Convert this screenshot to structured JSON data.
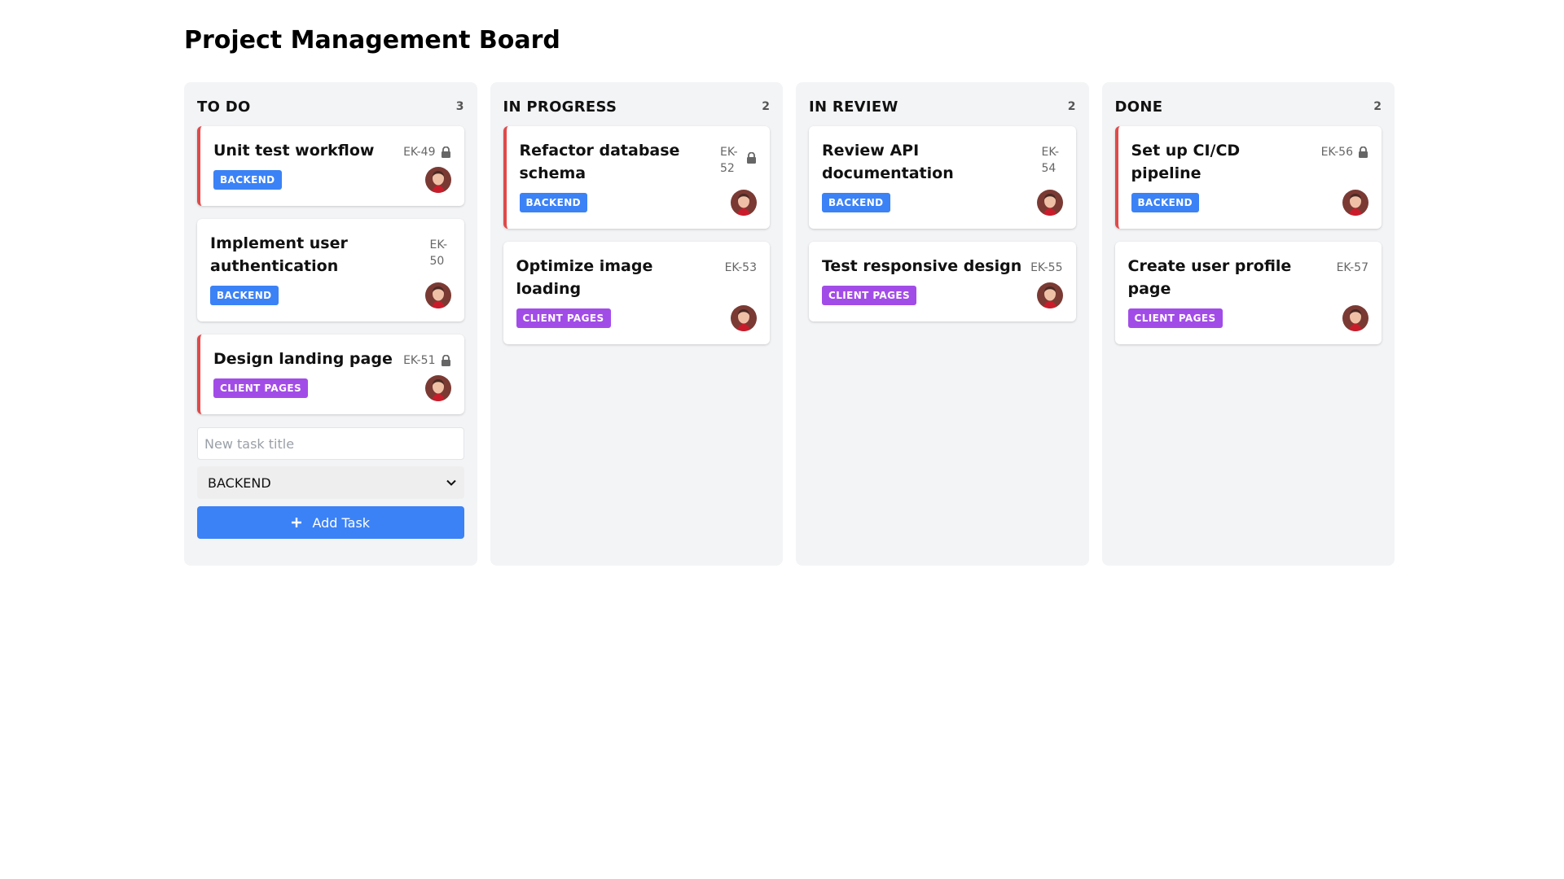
{
  "page_title": "Project Management Board",
  "columns": [
    {
      "title": "TO DO",
      "count": "3",
      "cards": [
        {
          "title": "Unit test workflow",
          "id": "EK-49",
          "tag": "BACKEND",
          "locked": true
        },
        {
          "title": "Implement user authentication",
          "id": "EK-50",
          "tag": "BACKEND",
          "locked": false
        },
        {
          "title": "Design landing page",
          "id": "EK-51",
          "tag": "CLIENT PAGES",
          "locked": true
        }
      ]
    },
    {
      "title": "IN PROGRESS",
      "count": "2",
      "cards": [
        {
          "title": "Refactor database schema",
          "id": "EK-52",
          "tag": "BACKEND",
          "locked": true
        },
        {
          "title": "Optimize image loading",
          "id": "EK-53",
          "tag": "CLIENT PAGES",
          "locked": false
        }
      ]
    },
    {
      "title": "IN REVIEW",
      "count": "2",
      "cards": [
        {
          "title": "Review API documentation",
          "id": "EK-54",
          "tag": "BACKEND",
          "locked": false
        },
        {
          "title": "Test responsive design",
          "id": "EK-55",
          "tag": "CLIENT PAGES",
          "locked": false
        }
      ]
    },
    {
      "title": "DONE",
      "count": "2",
      "cards": [
        {
          "title": "Set up CI/CD pipeline",
          "id": "EK-56",
          "tag": "BACKEND",
          "locked": true
        },
        {
          "title": "Create user profile page",
          "id": "EK-57",
          "tag": "CLIENT PAGES",
          "locked": false
        }
      ]
    }
  ],
  "new_task": {
    "placeholder": "New task title",
    "category_value": "BACKEND",
    "add_label": "Add Task"
  },
  "colors": {
    "backend": "#3b82f6",
    "client_pages": "#a24ce8",
    "lock_border": "#e04a4a",
    "column_bg": "#f3f4f6"
  },
  "icons": {
    "lock": "lock-icon",
    "avatar": "user-avatar",
    "chevron": "chevron-down-icon",
    "plus": "plus-icon"
  }
}
